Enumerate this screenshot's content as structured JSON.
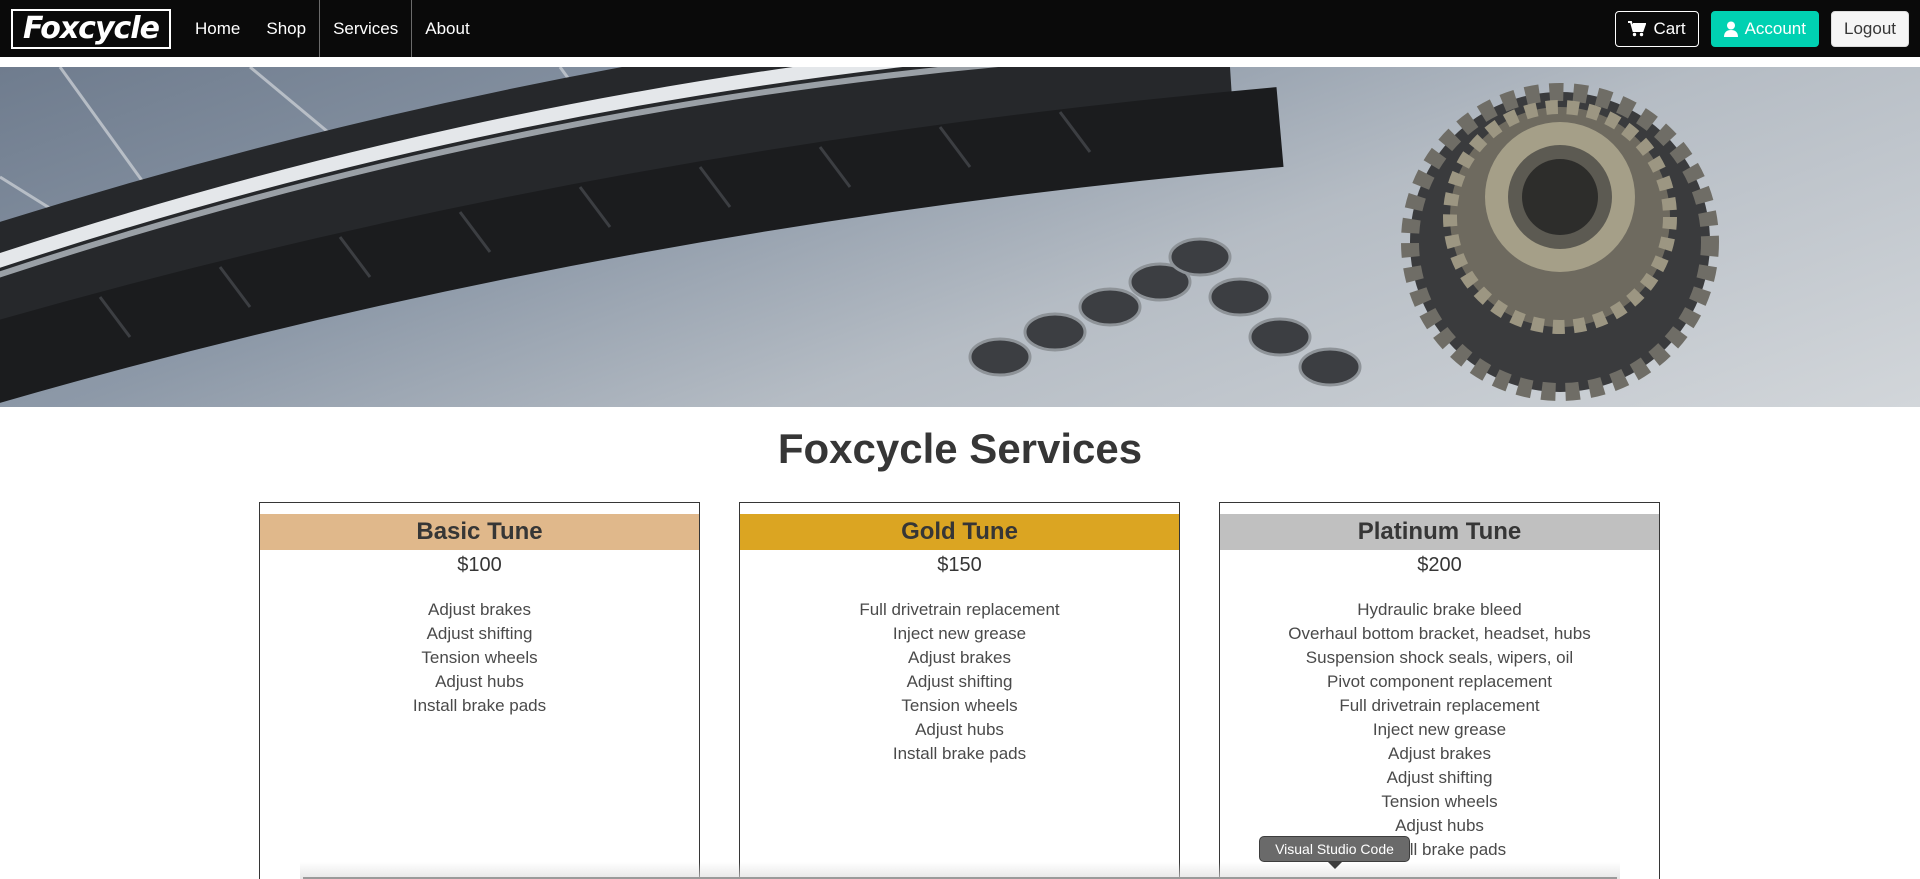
{
  "navbar": {
    "brand": "Foxcycle",
    "links": [
      {
        "label": "Home"
      },
      {
        "label": "Shop"
      },
      {
        "label": "Services"
      },
      {
        "label": "About"
      }
    ],
    "active_link": "Services",
    "cart_label": "Cart",
    "cart_icon": "shopping-cart-icon",
    "account_label": "Account",
    "account_icon": "user-icon",
    "logout_label": "Logout"
  },
  "hero": {
    "image": "bike-parts-wheel-chain-cassette"
  },
  "main": {
    "title": "Foxcycle Services",
    "plans": [
      {
        "name": "Basic Tune",
        "price": "$100",
        "color": "#e0b88b",
        "features": [
          "Adjust brakes",
          "Adjust shifting",
          "Tension wheels",
          "Adjust hubs",
          "Install brake pads"
        ]
      },
      {
        "name": "Gold Tune",
        "price": "$150",
        "color": "#dba522",
        "features": [
          "Full drivetrain replacement",
          "Inject new grease",
          "Adjust brakes",
          "Adjust shifting",
          "Tension wheels",
          "Adjust hubs",
          "Install brake pads"
        ]
      },
      {
        "name": "Platinum Tune",
        "price": "$200",
        "color": "#c0c0c0",
        "features": [
          "Hydraulic brake bleed",
          "Overhaul bottom bracket, headset, hubs",
          "Suspension shock seals, wipers, oil",
          "Pivot component replacement",
          "Full drivetrain replacement",
          "Inject new grease",
          "Adjust brakes",
          "Adjust shifting",
          "Tension wheels",
          "Adjust hubs",
          "Install brake pads"
        ]
      }
    ]
  },
  "tooltip": {
    "text": "Visual Studio Code"
  },
  "colors": {
    "navbar": "#0a0a0a",
    "account_button": "#00d1b2",
    "text": "#363636"
  }
}
